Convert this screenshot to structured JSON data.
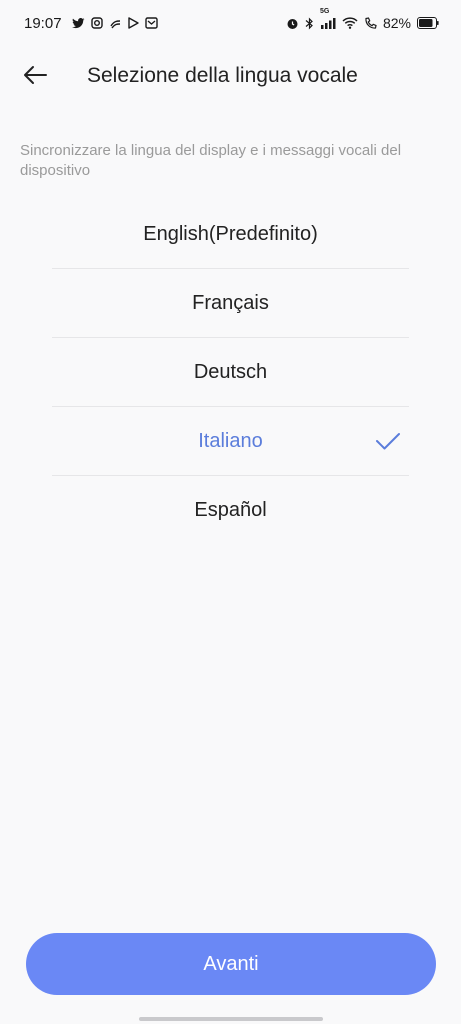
{
  "status_bar": {
    "time": "19:07",
    "network": "5G",
    "battery_percent": "82%",
    "left_icons": [
      "twitter-icon",
      "instagram-icon",
      "link-app-icon",
      "play-store-icon",
      "mail-icon"
    ],
    "right_icons": [
      "alarm-icon",
      "bluetooth-icon",
      "signal-icon",
      "wifi-icon",
      "call-icon",
      "battery-icon"
    ]
  },
  "header": {
    "back_icon": "arrow-left-icon",
    "title": "Selezione della lingua vocale"
  },
  "description": "Sincronizzare la lingua del display e i messaggi vocali del dispositivo",
  "languages": [
    {
      "label": "English(Predefinito)",
      "selected": false
    },
    {
      "label": "Français",
      "selected": false
    },
    {
      "label": "Deutsch",
      "selected": false
    },
    {
      "label": "Italiano",
      "selected": true
    },
    {
      "label": "Español",
      "selected": false
    }
  ],
  "colors": {
    "accent": "#6a88f5",
    "selected_text": "#5b7ddb",
    "description_text": "#9a9a9a",
    "divider": "#e6e6e8"
  },
  "footer": {
    "next_label": "Avanti"
  }
}
